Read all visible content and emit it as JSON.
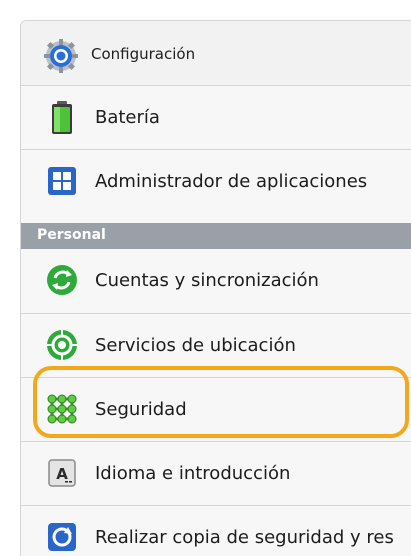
{
  "header": {
    "title": "Configuración",
    "icon": "gear-icon"
  },
  "items": [
    {
      "label": "Batería",
      "icon": "battery-icon"
    },
    {
      "label": "Administrador de aplicaciones",
      "icon": "apps-grid-icon"
    }
  ],
  "section": {
    "label": "Personal"
  },
  "personal_items": [
    {
      "label": "Cuentas y sincronización",
      "icon": "sync-icon"
    },
    {
      "label": "Servicios de ubicación",
      "icon": "location-icon"
    },
    {
      "label": "Seguridad",
      "icon": "security-pattern-icon"
    },
    {
      "label": "Idioma e introducción",
      "icon": "keyboard-icon"
    },
    {
      "label": "Realizar copia de seguridad y res",
      "icon": "backup-icon"
    }
  ],
  "colors": {
    "section_header_bg": "#9aa0a7",
    "highlight_outline": "#f2a81b"
  }
}
